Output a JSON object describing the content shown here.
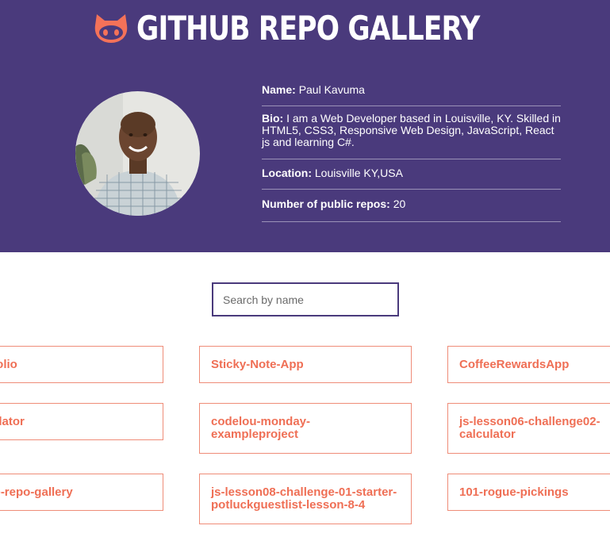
{
  "header": {
    "title": "GITHUB REPO GALLERY",
    "brand_color": "#4a3a7c",
    "logo_icon": "octocat-icon",
    "logo_color": "#f47259"
  },
  "profile": {
    "avatar_alt": "profile photo",
    "name_label": "Name:",
    "name": "Paul Kavuma",
    "bio_label": "Bio:",
    "bio": "I am a Web Developer based in Louisville, KY. Skilled in HTML5, CSS3, Responsive Web Design, JavaScript, React js and learning C#.",
    "location_label": "Location:",
    "location": "Louisville KY,USA",
    "repos_label": "Number of public repos:",
    "repos_count": "20"
  },
  "search": {
    "placeholder": "Search by name",
    "value": ""
  },
  "repos": [
    {
      "name": "portfolio"
    },
    {
      "name": "Sticky-Note-App"
    },
    {
      "name": "CoffeeRewardsApp"
    },
    {
      "name": "calculator"
    },
    {
      "name": "codelou-monday-exampleproject"
    },
    {
      "name": "js-lesson06-challenge02-calculator"
    },
    {
      "name": "github-repo-gallery"
    },
    {
      "name": "js-lesson08-challenge-01-starter-potluckguestlist-lesson-8-4"
    },
    {
      "name": "101-rogue-pickings"
    }
  ],
  "accent_color": "#ef6f55"
}
